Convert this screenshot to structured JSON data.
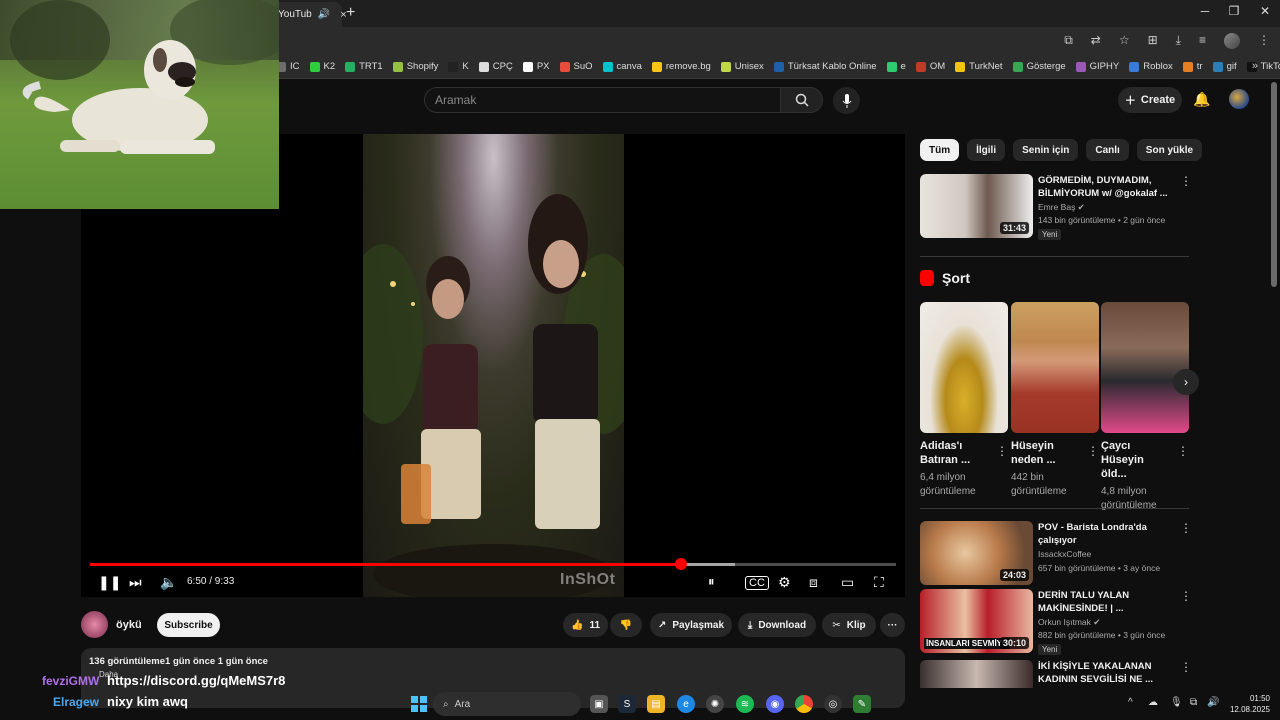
{
  "browser": {
    "tab_title": "YouTub",
    "tab_close": "×",
    "new_tab": "+",
    "window": {
      "minimize": "─",
      "restore": "❐",
      "close": "✕"
    }
  },
  "bookmarks": [
    {
      "label": "IC",
      "color": "#6d6d6d"
    },
    {
      "label": "K2",
      "color": "#2ecc40"
    },
    {
      "label": "TRT1",
      "color": "#27ae60"
    },
    {
      "label": "Shopify",
      "color": "#95bf47"
    },
    {
      "label": "K",
      "color": "#222222"
    },
    {
      "label": "CPÇ",
      "color": "#dddddd"
    },
    {
      "label": "PX",
      "color": "#ffffff"
    },
    {
      "label": "SuO",
      "color": "#e74c3c"
    },
    {
      "label": "canva",
      "color": "#00c4cc"
    },
    {
      "label": "remove.bg",
      "color": "#f5c518"
    },
    {
      "label": "Unisex",
      "color": "#c0d84a"
    },
    {
      "label": "Türksat Kablo Online",
      "color": "#1f5fa8"
    },
    {
      "label": "e",
      "color": "#2ecc71"
    },
    {
      "label": "OM",
      "color": "#c0392b"
    },
    {
      "label": "TurkNet",
      "color": "#f1c40f"
    },
    {
      "label": "Gösterge",
      "color": "#34a853"
    },
    {
      "label": "GIPHY",
      "color": "#9b59b6"
    },
    {
      "label": "Roblox",
      "color": "#3a7bd5"
    },
    {
      "label": "tr",
      "color": "#e67e22"
    },
    {
      "label": "gif",
      "color": "#2980b9"
    },
    {
      "label": "TikTok",
      "color": "#111111"
    }
  ],
  "header": {
    "search_placeholder": "Aramak",
    "create_label": "Create"
  },
  "player": {
    "time": "6:50 / 9:33",
    "progress": 0.7335,
    "buffered": 0.8,
    "watermark": "InShOt"
  },
  "below": {
    "channel": "öykü",
    "subscribe": "Subscribe",
    "likes": "11",
    "share": "Paylaşmak",
    "download": "Download",
    "clip": "Klip",
    "more": "···",
    "desc_line": "136 görüntüleme1 gün önce  1 gün önce",
    "desc_more": "Daha"
  },
  "overlay": {
    "user1": "fevziGMW",
    "msg1": "https://discord.gg/qMeMS7r8",
    "user2": "Elragew",
    "msg2": "nixy kim awq"
  },
  "chips": [
    "Tüm",
    "İlgili",
    "Senin için",
    "Canlı",
    "Son yükle"
  ],
  "recs_top": [
    {
      "title": "GÖRMEDİM, DUYMADIM, BİLMİYORUM w/ @gokalaf ...",
      "channel": "Emre Baş ✔",
      "meta": "143 bin görüntüleme • 2 gün önce",
      "badge": "Yeni",
      "duration": "31:43"
    }
  ],
  "shorts": {
    "heading": "Şort",
    "items": [
      {
        "title": "Adidas'ı Batıran ...",
        "views": "6,4 milyon görüntüleme"
      },
      {
        "title": "Hüseyin neden ...",
        "views": "442 bin görüntüleme"
      },
      {
        "title": "Çaycı Hüseyin öld...",
        "views": "4,8 milyon görüntüleme"
      }
    ]
  },
  "recs_bottom": [
    {
      "title": "POV - Barista Londra'da çalışıyor",
      "channel": "IssackxCoffee",
      "meta": "657 bin görüntüleme • 3 ay önce",
      "badge": "",
      "duration": "24:03"
    },
    {
      "title": "DERİN TALU YALAN MAKİNESİNDE! | ...",
      "channel": "Orkun Işıtmak ✔",
      "meta": "882 bin görüntüleme • 3 gün önce",
      "badge": "Yeni",
      "duration": "30:10",
      "thumb_text": "İNSANLARI SEVMİYO"
    },
    {
      "title": "İKİ KİŞİYLE YAKALANAN KADININ SEVGİLİSİ NE ...",
      "channel": "",
      "meta": "",
      "badge": "",
      "duration": ""
    }
  ],
  "taskbar": {
    "search": "Ara",
    "time": "01:50",
    "date": "12.08.2025"
  }
}
